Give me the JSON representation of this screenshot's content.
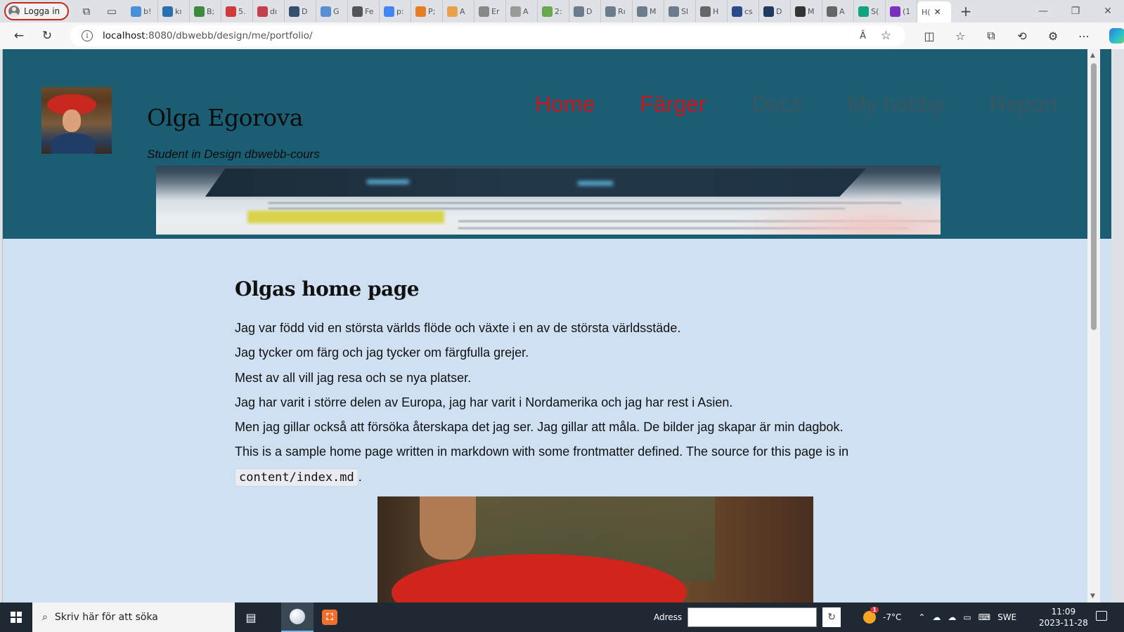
{
  "browser": {
    "profile_label": "Logga in",
    "tabs": [
      {
        "label": "b!",
        "color": "#4a90d9"
      },
      {
        "label": "kı",
        "color": "#2a6fb0"
      },
      {
        "label": "B;",
        "color": "#3c8a3c"
      },
      {
        "label": "5.",
        "color": "#d23a3a"
      },
      {
        "label": "dı",
        "color": "#c2414b"
      },
      {
        "label": "D",
        "color": "#34506e"
      },
      {
        "label": "G",
        "color": "#5a8fd6"
      },
      {
        "label": "Fe",
        "color": "#555555"
      },
      {
        "label": "p:",
        "color": "#4285f4"
      },
      {
        "label": "P;",
        "color": "#e67e22"
      },
      {
        "label": "A",
        "color": "#e8a34a"
      },
      {
        "label": "Er",
        "color": "#888888"
      },
      {
        "label": "A",
        "color": "#9a9a9a"
      },
      {
        "label": "2:",
        "color": "#6aa84f"
      },
      {
        "label": "D",
        "color": "#6b7d8c"
      },
      {
        "label": "Rı",
        "color": "#6b7d8c"
      },
      {
        "label": "M",
        "color": "#6b7d8c"
      },
      {
        "label": "Sl",
        "color": "#6b7d8c"
      },
      {
        "label": "H",
        "color": "#666666"
      },
      {
        "label": "cs",
        "color": "#2b4a8a"
      },
      {
        "label": "D",
        "color": "#1e3a5f"
      },
      {
        "label": "M",
        "color": "#333333"
      },
      {
        "label": "A",
        "color": "#666666"
      },
      {
        "label": "S(",
        "color": "#10a37f"
      },
      {
        "label": "(1",
        "color": "#7b2fbf"
      }
    ],
    "active_tab": {
      "label": "H("
    },
    "new_tab": "+",
    "url_host": "localhost",
    "url_path": ":8080/dbwebb/design/me/portfolio/",
    "read_aloud": "Â"
  },
  "site": {
    "title": "Olga Egorova",
    "slogan": "Student in Design dbwebb-cours",
    "nav": [
      {
        "label": "Home",
        "current": true
      },
      {
        "label": "Färger",
        "current": true
      },
      {
        "label": "Docs",
        "current": false
      },
      {
        "label": "My hobby",
        "current": false
      },
      {
        "label": "Report",
        "current": false
      }
    ],
    "accent": "#c8141c",
    "header_bg": "#1b5e73",
    "page_bg": "#cfe0f2"
  },
  "content": {
    "heading": "Olgas home page",
    "paragraphs": [
      "Jag var född vid en största världs flöde och växte i en av de största världsstäde.",
      "Jag tycker om färg och jag tycker om färgfulla grejer.",
      "Mest av all vill jag resa och se nya platser.",
      "Jag har varit i större delen av Europa, jag har varit i Nordamerika och jag har rest i Asien.",
      "Men jag gillar också att försöka återskapa det jag ser. Jag gillar att måla. De bilder jag skapar är min dagbok."
    ],
    "sample_text": "This is a sample home page written in markdown with some frontmatter defined. The source for this page is in",
    "code": "content/index.md",
    "trail": "."
  },
  "taskbar": {
    "search_placeholder": "Skriv här för att söka",
    "address_label": "Adress",
    "temperature": "-7°C",
    "weather_badge": "1",
    "language": "SWE",
    "time": "11:09",
    "date": "2023-11-28"
  }
}
